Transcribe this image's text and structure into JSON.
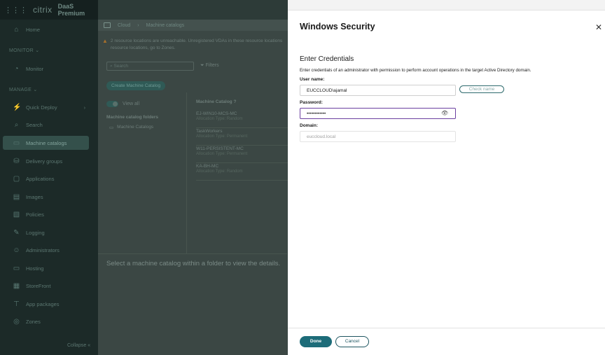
{
  "app": {
    "brand": "citrix",
    "product": "DaaS Premium"
  },
  "sidebar": {
    "items": [
      {
        "label": "Home",
        "icon": "home-icon",
        "glyph": "⌂"
      },
      {
        "label": "Quick Deploy",
        "icon": "quick-deploy-icon",
        "glyph": "⚡"
      },
      {
        "label": "Search",
        "icon": "search-icon",
        "glyph": "⌕"
      },
      {
        "label": "Machine catalogs",
        "icon": "machine-catalogs-icon",
        "glyph": "▭"
      },
      {
        "label": "Delivery groups",
        "icon": "delivery-groups-icon",
        "glyph": "⛁"
      },
      {
        "label": "Applications",
        "icon": "applications-icon",
        "glyph": "▢"
      },
      {
        "label": "Images",
        "icon": "images-icon",
        "glyph": "▤"
      },
      {
        "label": "Policies",
        "icon": "policies-icon",
        "glyph": "▧"
      },
      {
        "label": "Logging",
        "icon": "logging-icon",
        "glyph": "✎"
      },
      {
        "label": "Administrators",
        "icon": "administrators-icon",
        "glyph": "☺"
      },
      {
        "label": "Hosting",
        "icon": "hosting-icon",
        "glyph": "▭"
      },
      {
        "label": "StoreFront",
        "icon": "storefront-icon",
        "glyph": "▦"
      },
      {
        "label": "App packages",
        "icon": "app-packages-icon",
        "glyph": "⊤"
      },
      {
        "label": "Zones",
        "icon": "zones-icon",
        "glyph": "◎"
      }
    ],
    "section_monitor": "MONITOR",
    "monitor_item": "Monitor",
    "section_manage": "MANAGE",
    "collapse_label": "Collapse"
  },
  "main": {
    "breadcrumb_root": "Cloud",
    "breadcrumb_current": "Machine catalogs",
    "warning_line1": "2 resource locations are unreachable. Unregistered VDAs in these resource locations",
    "warning_line2": "resource locations, go to Zones.",
    "search_placeholder": "Search",
    "filters_label": "Filters",
    "create_button": "Create Machine Catalog",
    "view_all": "View all",
    "folders_header": "Machine catalog folders",
    "folder_name": "Machine Catalogs",
    "column_header": "Machine Catalog",
    "catalogs": [
      {
        "name": "EJ-WIN10-MCS-MC",
        "type": "Allocation Type: Random"
      },
      {
        "name": "TaskWorkers",
        "type": "Allocation Type: Permanent"
      },
      {
        "name": "W11-PERSISTENT-MC",
        "type": "Allocation Type: Permanent"
      },
      {
        "name": "KA-BH-MC",
        "type": "Allocation Type: Random"
      }
    ],
    "empty_detail": "Select a machine catalog within a folder to view the details."
  },
  "dialog": {
    "title": "Windows Security",
    "section_title": "Enter Credentials",
    "description": "Enter credentials of an administrator with permission to perform account operations in the target Active Directory domain.",
    "username_label": "User name:",
    "username_value": "EUCCLOUD\\ajamal",
    "check_name_label": "Check name",
    "password_label": "Password:",
    "password_value": "••••••••••••",
    "domain_label": "Domain:",
    "domain_placeholder": "euccloud.local",
    "done_label": "Done",
    "cancel_label": "Cancel"
  }
}
